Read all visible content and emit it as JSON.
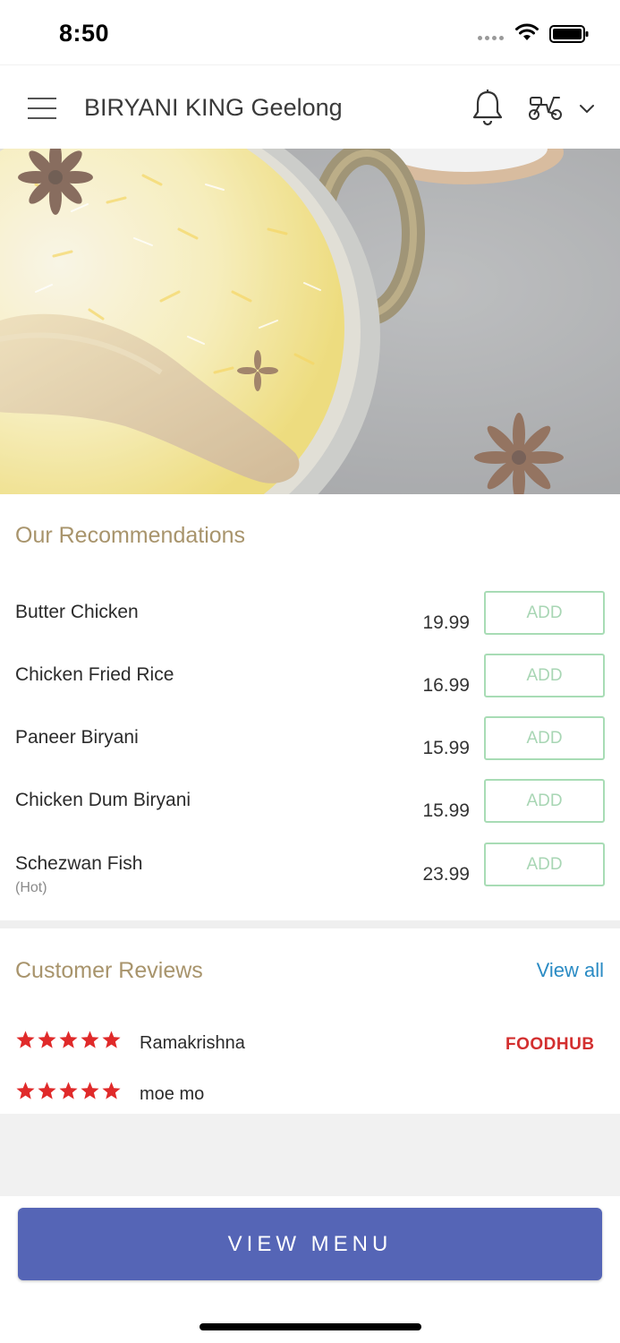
{
  "status_bar": {
    "time": "8:50"
  },
  "header": {
    "title": "BIRYANI KING Geelong"
  },
  "recommendations": {
    "title": "Our Recommendations",
    "items": [
      {
        "name": "Butter Chicken",
        "sub": "",
        "price": "19.99",
        "button": "ADD"
      },
      {
        "name": "Chicken Fried Rice",
        "sub": "",
        "price": "16.99",
        "button": "ADD"
      },
      {
        "name": "Paneer Biryani",
        "sub": "",
        "price": "15.99",
        "button": "ADD"
      },
      {
        "name": "Chicken Dum Biryani",
        "sub": "",
        "price": "15.99",
        "button": "ADD"
      },
      {
        "name": "Schezwan Fish",
        "sub": "(Hot)",
        "price": "23.99",
        "button": "ADD"
      }
    ]
  },
  "reviews": {
    "title": "Customer Reviews",
    "view_all": "View all",
    "items": [
      {
        "name": "Ramakrishna",
        "rating": 5,
        "source": "FOODHUB"
      },
      {
        "name": "moe mo",
        "rating": 5,
        "source": ""
      }
    ]
  },
  "cta": {
    "label": "VIEW MENU"
  },
  "colors": {
    "accent": "#5565b6",
    "section_title": "#a8946c",
    "link": "#2a8bc4",
    "add_border": "#a8dcb5",
    "star": "#e02a2a"
  },
  "icons": [
    "hamburger-menu-icon",
    "bell-icon",
    "scooter-icon",
    "chevron-down-icon",
    "star-icon",
    "wifi-icon",
    "battery-icon"
  ]
}
